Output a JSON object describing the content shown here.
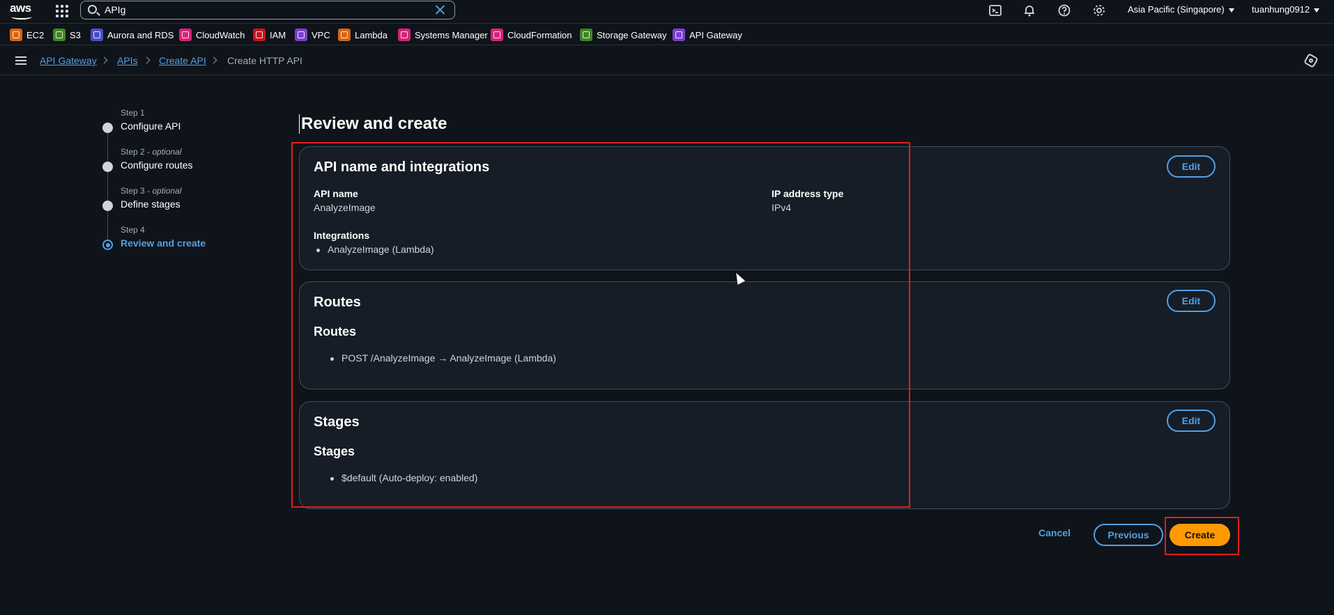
{
  "topbar": {
    "logo_text": "aws",
    "search_value": "APIg",
    "region": "Asia Pacific (Singapore)",
    "user": "tuanhung0912"
  },
  "favorites": [
    {
      "label": "EC2",
      "color": "#d86613"
    },
    {
      "label": "S3",
      "color": "#3f8624"
    },
    {
      "label": "Aurora and RDS",
      "color": "#4a4ec9"
    },
    {
      "label": "CloudWatch",
      "color": "#d6247a"
    },
    {
      "label": "IAM",
      "color": "#c7131f"
    },
    {
      "label": "VPC",
      "color": "#7a3fce"
    },
    {
      "label": "Lambda",
      "color": "#d86613"
    },
    {
      "label": "Systems Manager",
      "color": "#d6247a"
    },
    {
      "label": "CloudFormation",
      "color": "#d6247a"
    },
    {
      "label": "Storage Gateway",
      "color": "#3f8624"
    },
    {
      "label": "API Gateway",
      "color": "#7a3fce"
    }
  ],
  "breadcrumb": [
    "API Gateway",
    "APIs",
    "Create API",
    "Create HTTP API"
  ],
  "steps": [
    {
      "num": "Step 1",
      "optional": "",
      "title": "Configure API"
    },
    {
      "num": "Step 2 - ",
      "optional": "optional",
      "title": "Configure routes"
    },
    {
      "num": "Step 3 - ",
      "optional": "optional",
      "title": "Define stages"
    },
    {
      "num": "Step 4",
      "optional": "",
      "title": "Review and create"
    }
  ],
  "main": {
    "title": "Review and create",
    "card1": {
      "heading": "API name and integrations",
      "edit": "Edit",
      "api_name_label": "API name",
      "api_name_value": "AnalyzeImage",
      "ip_label": "IP address type",
      "ip_value": "IPv4",
      "integrations_label": "Integrations",
      "integration_item": "AnalyzeImage (Lambda)"
    },
    "card2": {
      "heading": "Routes",
      "edit": "Edit",
      "subheading": "Routes",
      "item": "POST /AnalyzeImage → AnalyzeImage (Lambda)"
    },
    "card3": {
      "heading": "Stages",
      "edit": "Edit",
      "subheading": "Stages",
      "item": "$default (Auto-deploy: enabled)"
    }
  },
  "footer": {
    "cancel": "Cancel",
    "previous": "Previous",
    "create": "Create"
  },
  "colors": {
    "accent": "#539fe5",
    "primary_button": "#ff9900",
    "highlight": "#e11d1d"
  }
}
